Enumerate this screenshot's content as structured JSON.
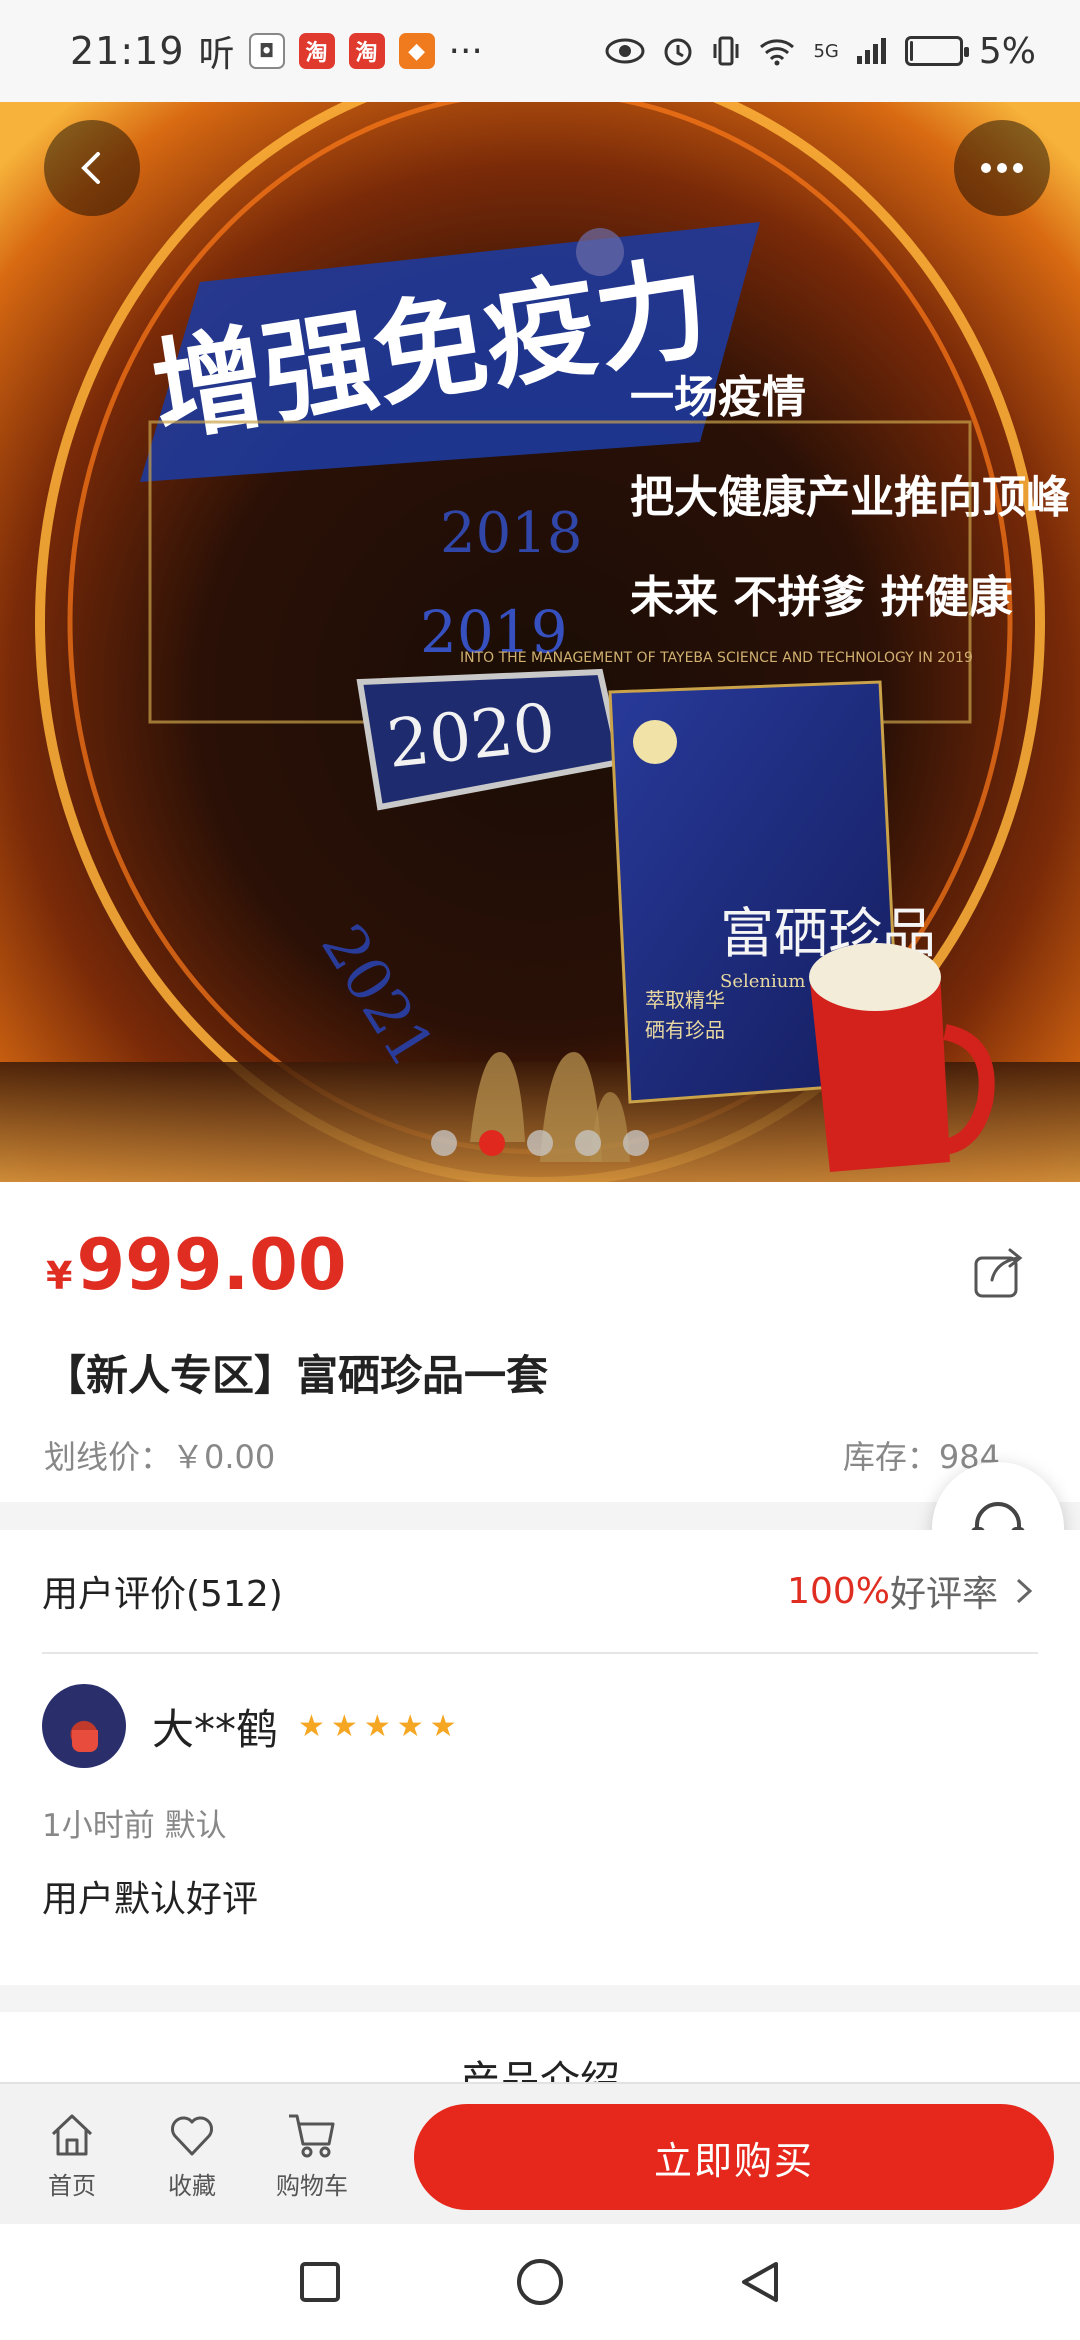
{
  "status_bar": {
    "time": "21:19",
    "listen_label": "听",
    "app_icons": [
      {
        "name": "taobao-live-icon",
        "text": "◘",
        "color": "#444444"
      },
      {
        "name": "taobao-icon",
        "text": "淘",
        "color": "#e03a2f"
      },
      {
        "name": "taobao-icon",
        "text": "淘",
        "color": "#e03a2f"
      },
      {
        "name": "tmall-icon",
        "text": "◆",
        "color": "#f07a1e"
      }
    ],
    "more_dots": "···",
    "network": "5G",
    "battery_percent": "5%",
    "battery_level": 0.05
  },
  "banner": {
    "headline": "增强免疫力",
    "lines": [
      "一场疫情",
      "把大健康产业推向顶峰",
      "未来 不拼爹 拼健康"
    ],
    "years": [
      "2018",
      "2019",
      "2020",
      "2021"
    ],
    "english_line": "INTO THE MANAGEMENT OF TAYEBA SCIENCE AND TECHNOLOGY IN 2019",
    "box_title": "富硒珍品",
    "box_sub": "Selenium treasures",
    "box_side1": "萃取精华",
    "box_side2": "硒有珍品",
    "slide_count": 5,
    "active_slide": 1
  },
  "product": {
    "currency": "¥",
    "price": "999.00",
    "title": "【新人专区】富硒珍品一套",
    "strike_price_label": "划线价：￥0.00",
    "stock_label": "库存：984"
  },
  "reviews": {
    "header": "用户评价(512)",
    "rate_pct": "100%",
    "rate_label": "好评率",
    "user_name": "大**鹤",
    "stars": [
      "★",
      "★",
      "★",
      "★",
      "★"
    ],
    "meta": "1小时前 默认",
    "text": "用户默认好评"
  },
  "intro": {
    "title": "产品介绍"
  },
  "actions": {
    "home": "首页",
    "favorite": "收藏",
    "cart": "购物车",
    "buy": "立即购买"
  },
  "colors": {
    "accent": "#e5271c",
    "price": "#e02d22",
    "star": "#f5a623"
  }
}
